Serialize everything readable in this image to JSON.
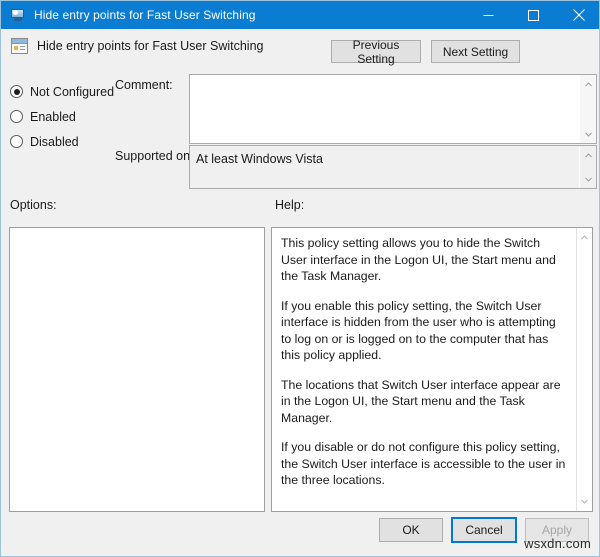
{
  "window": {
    "title": "Hide entry points for Fast User Switching",
    "icon": "fast-user-switching-icon",
    "controls": {
      "minimize": "minimize-icon",
      "maximize": "maximize-icon",
      "close": "close-icon"
    }
  },
  "header": {
    "icon": "policy-setting-icon",
    "title": "Hide entry points for Fast User Switching",
    "previous_label": "Previous Setting",
    "next_label": "Next Setting"
  },
  "state_options": [
    {
      "label": "Not Configured",
      "selected": true
    },
    {
      "label": "Enabled",
      "selected": false
    },
    {
      "label": "Disabled",
      "selected": false
    }
  ],
  "comment": {
    "label": "Comment:",
    "value": "",
    "placeholder": ""
  },
  "supported_on": {
    "label": "Supported on:",
    "value": "At least Windows Vista"
  },
  "options": {
    "label": "Options:",
    "content": ""
  },
  "help": {
    "label": "Help:",
    "paragraphs": [
      "This policy setting allows you to hide the Switch User interface in the Logon UI, the Start menu and the Task Manager.",
      "If you enable this policy setting, the Switch User interface is hidden from the user who is attempting to log on or is logged on to the computer that has this policy applied.",
      "The locations that Switch User interface appear are in the Logon UI, the Start menu and the Task Manager.",
      "If you disable or do not configure this policy setting, the Switch User interface is accessible to the user in the three locations."
    ]
  },
  "footer": {
    "ok_label": "OK",
    "cancel_label": "Cancel",
    "apply_label": "Apply"
  },
  "watermark": "wsxdn.com",
  "colors": {
    "titlebar": "#0a7cd1",
    "dialog_bg": "#f0f0f0",
    "accent": "#0078d7",
    "border": "#9ec3dd"
  }
}
